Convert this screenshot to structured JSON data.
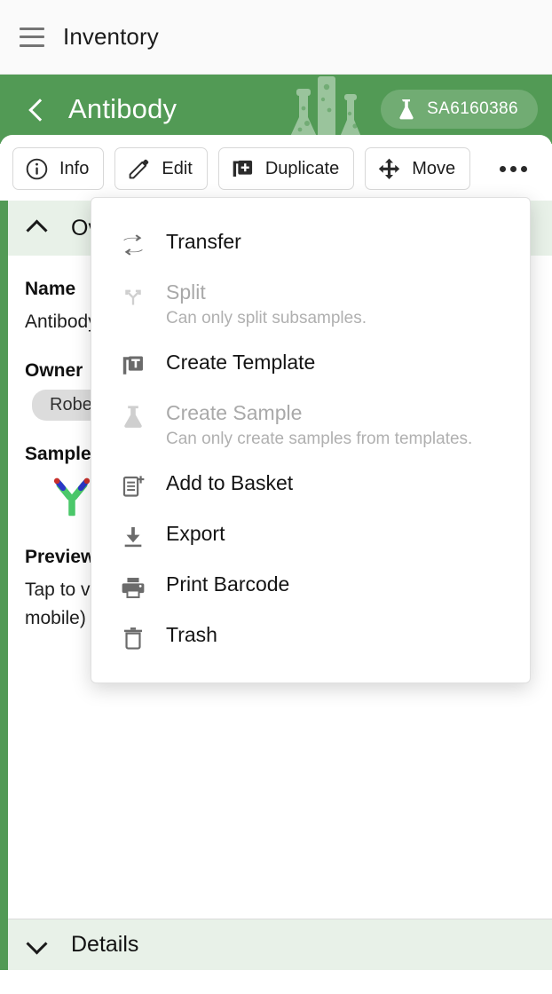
{
  "appbar": {
    "menu_icon": "hamburger-icon",
    "title": "Inventory"
  },
  "header": {
    "back_icon": "chevron-left-icon",
    "title": "Antibody",
    "decoration_icon": "lab-glassware-illustration",
    "barcode_chip": {
      "icon": "flask-icon",
      "label": "SA6160386"
    },
    "background_color": "#529a55"
  },
  "toolbar": {
    "buttons": [
      {
        "label": "Info",
        "icon": "info-circle-icon"
      },
      {
        "label": "Edit",
        "icon": "pencil-icon"
      },
      {
        "label": "Duplicate",
        "icon": "duplicate-plus-icon"
      },
      {
        "label": "Move",
        "icon": "move-arrows-icon"
      }
    ],
    "overflow_icon": "more-horizontal-icon"
  },
  "overview": {
    "chevron_icon": "chevron-up-icon",
    "title": "Overview",
    "fields": [
      {
        "label": "Name",
        "value": "Antibody"
      },
      {
        "label": "Owner",
        "value": "Robert"
      },
      {
        "label": "Sample Type",
        "value": "🧬"
      },
      {
        "label": "Preview",
        "value": "Tap to view",
        "value2": "mobile)"
      }
    ],
    "antibody_icon": "antibody-y-icon",
    "preview_graphic_icon": "preview-green-graphic"
  },
  "details": {
    "chevron_icon": "chevron-down-icon",
    "title": "Details"
  },
  "overflow_menu": {
    "items": [
      {
        "label": "Transfer",
        "icon": "transfer-hands-icon",
        "disabled": false,
        "sublabel": ""
      },
      {
        "label": "Split",
        "icon": "split-branch-icon",
        "disabled": true,
        "sublabel": "Can only split subsamples."
      },
      {
        "label": "Create Template",
        "icon": "template-document-icon",
        "disabled": false,
        "sublabel": ""
      },
      {
        "label": "Create Sample",
        "icon": "flask-icon",
        "disabled": true,
        "sublabel": "Can only create samples from templates."
      },
      {
        "label": "Add to Basket",
        "icon": "add-to-basket-icon",
        "disabled": false,
        "sublabel": ""
      },
      {
        "label": "Export",
        "icon": "download-icon",
        "disabled": false,
        "sublabel": ""
      },
      {
        "label": "Print Barcode",
        "icon": "printer-icon",
        "disabled": false,
        "sublabel": ""
      },
      {
        "label": "Trash",
        "icon": "trash-icon",
        "disabled": false,
        "sublabel": ""
      }
    ]
  }
}
